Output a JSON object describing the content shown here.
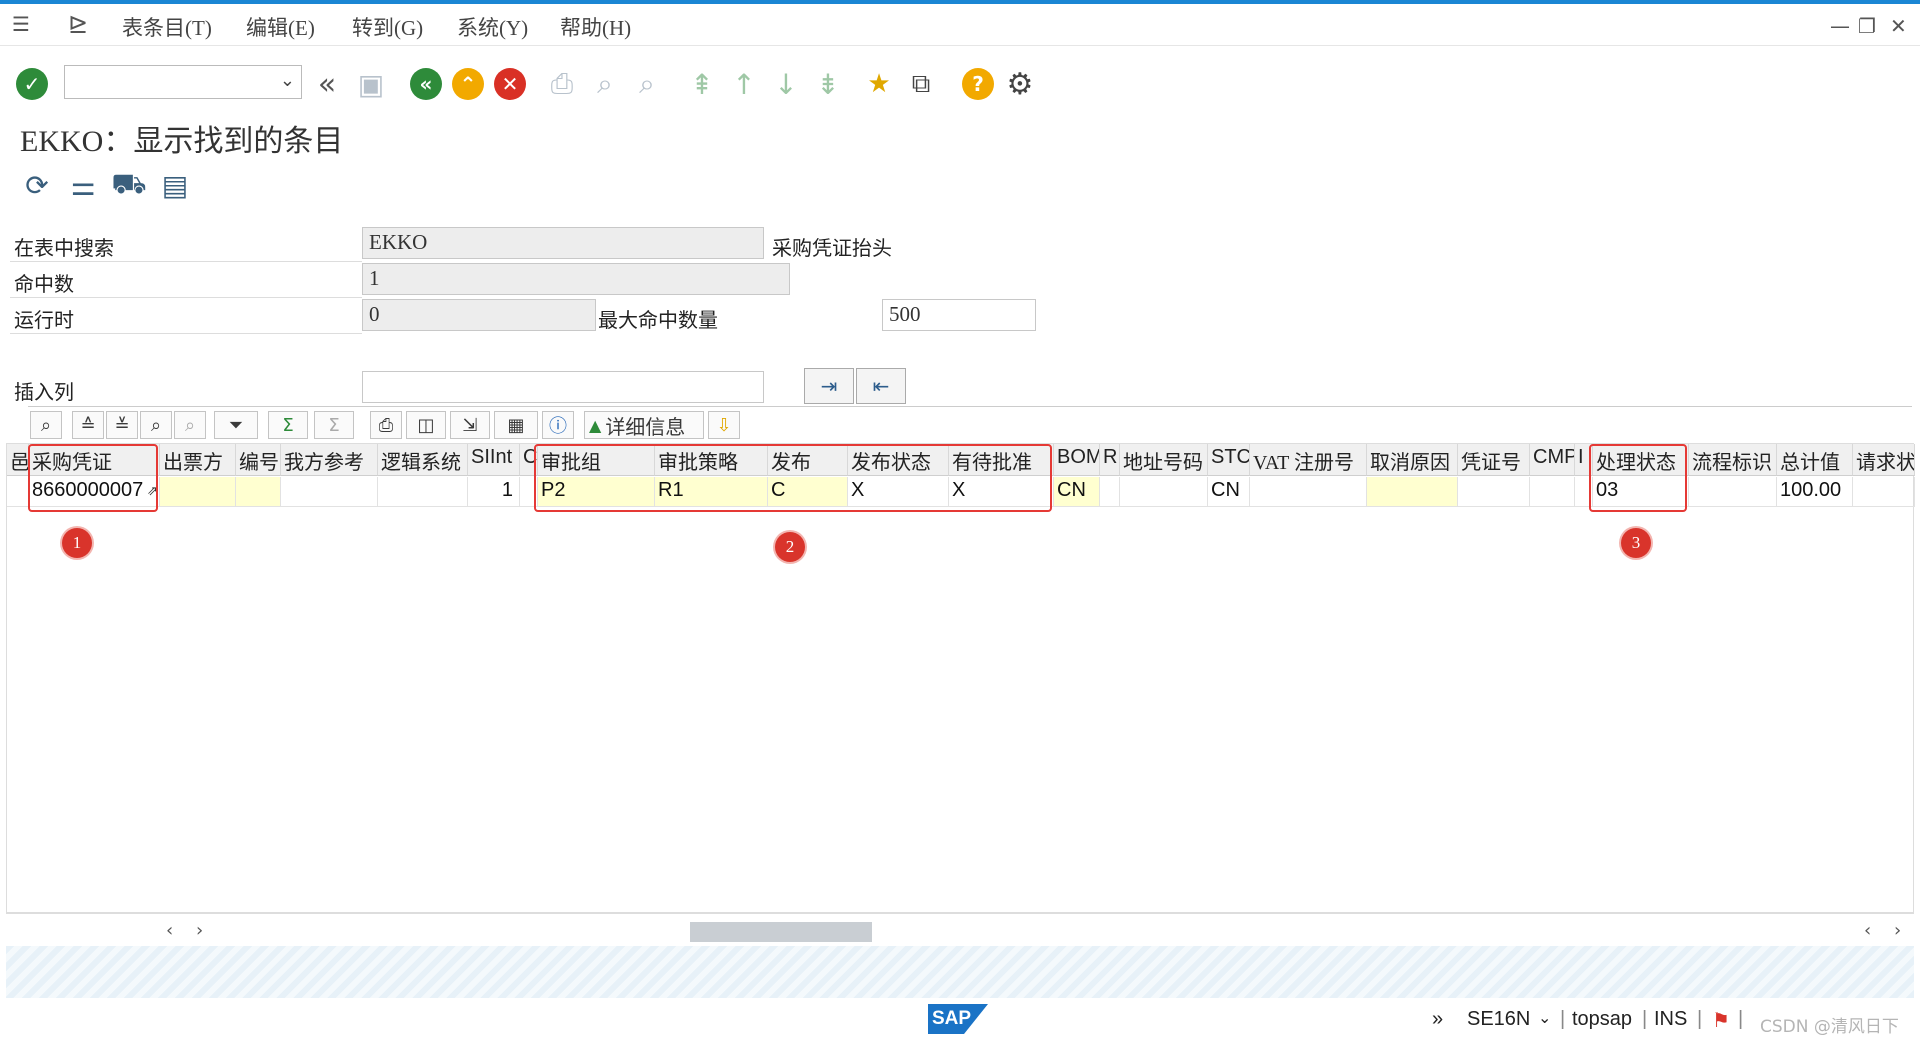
{
  "menu": {
    "items": [
      "表条目(T)",
      "编辑(E)",
      "转到(G)",
      "系统(Y)",
      "帮助(H)"
    ]
  },
  "toolbar": {
    "command_field": "",
    "icons": [
      "check-icon",
      "back-double-icon",
      "save-icon",
      "back-icon",
      "exit-icon",
      "cancel-icon",
      "print-icon",
      "find-icon",
      "find-next-icon",
      "first-page-icon",
      "prev-page-icon",
      "next-page-icon",
      "last-page-icon",
      "new-session-icon",
      "shortcut-icon",
      "help-icon",
      "settings-icon"
    ]
  },
  "page": {
    "title": "EKKO：显示找到的条目"
  },
  "form": {
    "search_table_label": "在表中搜索",
    "search_table_value": "EKKO",
    "search_table_desc": "采购凭证抬头",
    "hits_label": "命中数",
    "hits_value": "1",
    "runtime_label": "运行时",
    "runtime_value": "0",
    "max_hits_label": "最大命中数量",
    "max_hits_value": "500",
    "insert_col_label": "插入列",
    "insert_col_value": ""
  },
  "gridbar": {
    "details_label": "详细信息"
  },
  "grid": {
    "columns": [
      "邑",
      "采购凭证",
      "出票方",
      "编号",
      "我方参考",
      "逻辑系统",
      "SIInt",
      "C",
      "审批组",
      "审批策略",
      "发布",
      "发布状态",
      "有待批准",
      "BOM",
      "R",
      "地址号码",
      "STC",
      "VAT 注册号",
      "取消原因",
      "凭证号",
      "CMP",
      "I",
      "处理状态",
      "流程标识",
      "总计值",
      "请求状"
    ],
    "row": [
      "",
      "8660000007",
      "",
      "",
      "",
      "",
      "1",
      "",
      "P2",
      "R1",
      "C",
      "X",
      "X",
      "CN",
      "",
      "",
      "CN",
      "",
      "",
      "",
      "",
      "",
      "03",
      "",
      "100.00",
      ""
    ]
  },
  "annotations": [
    "1",
    "2",
    "3"
  ],
  "status": {
    "sap_logo": "SAP",
    "expand": "»",
    "transaction": "SE16N",
    "system": "topsap",
    "mode": "INS",
    "watermark": "CSDN @清风日下"
  },
  "colors": {
    "accent_blue": "#1a86d4",
    "highlight_red": "#e53935",
    "cell_yellow": "#ffffd0"
  }
}
